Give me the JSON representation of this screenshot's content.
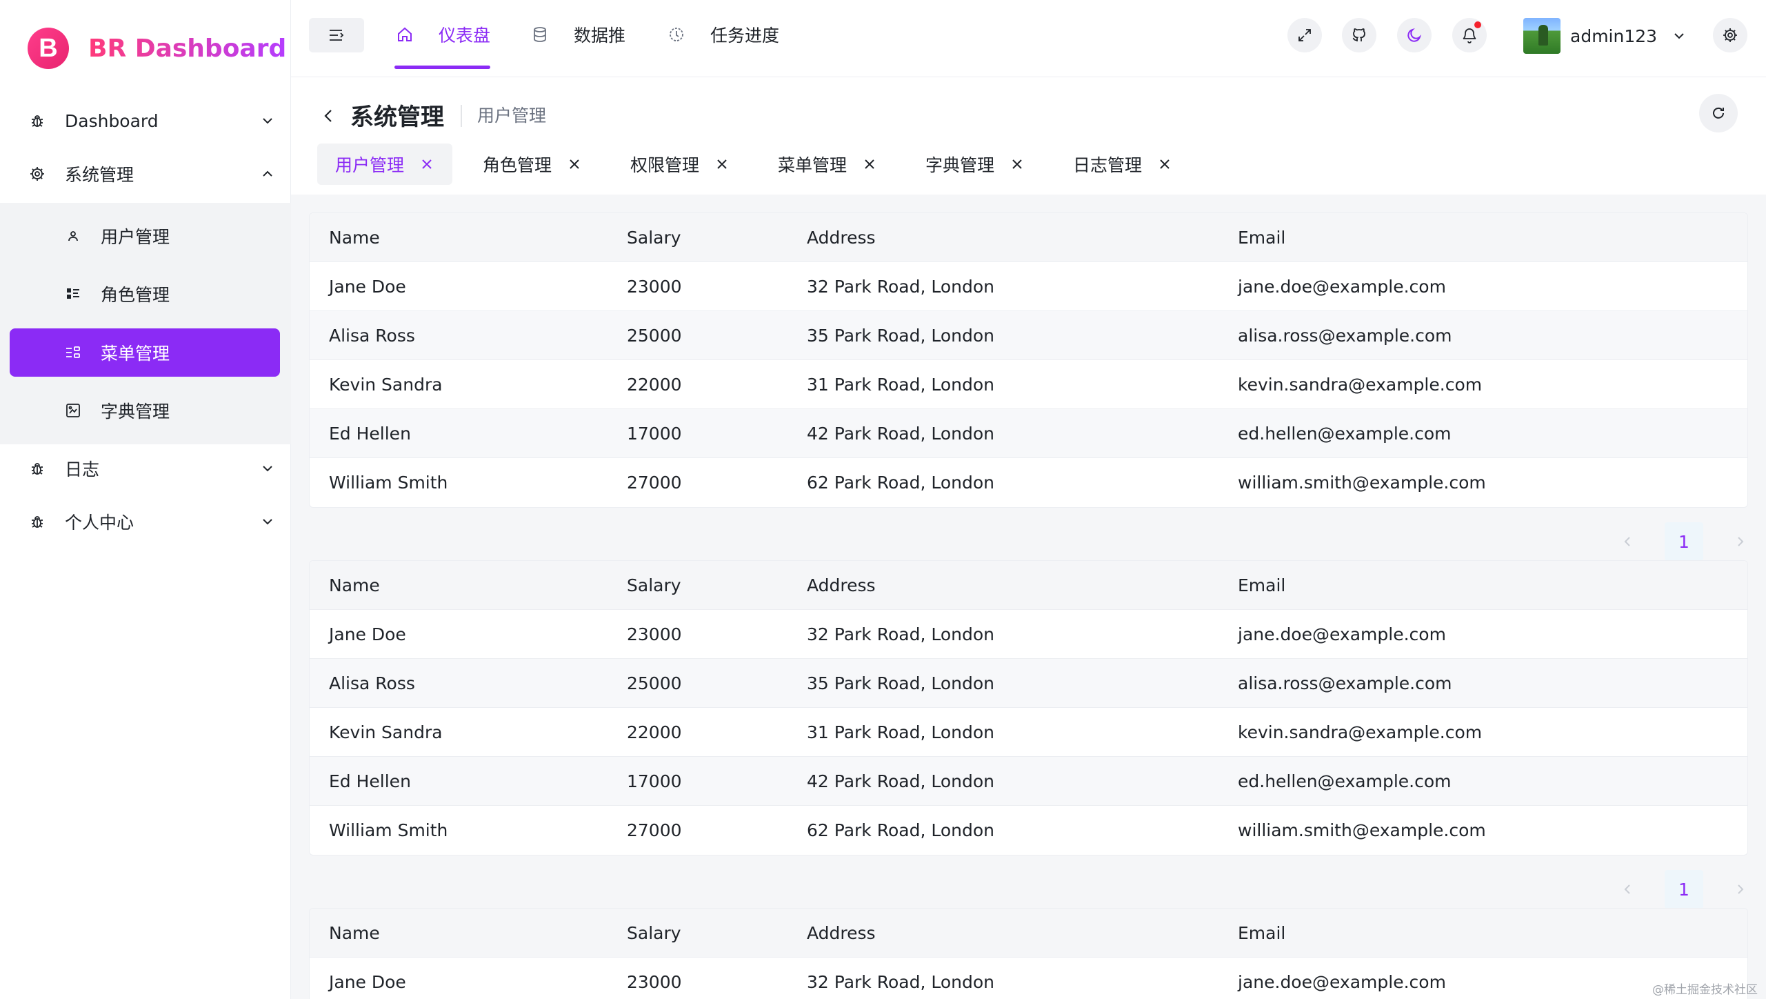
{
  "app": {
    "logo_letter": "B",
    "logo_text": "BR Dashboard"
  },
  "sidebar": {
    "groups": [
      {
        "label": "Dashboard",
        "icon": "bug-icon",
        "expanded": false
      },
      {
        "label": "系统管理",
        "icon": "gear-icon",
        "expanded": true
      },
      {
        "label": "日志",
        "icon": "bug-icon",
        "expanded": false
      },
      {
        "label": "个人中心",
        "icon": "bug-icon",
        "expanded": false
      }
    ],
    "sub_items": [
      {
        "label": "用户管理",
        "icon": "user-icon"
      },
      {
        "label": "角色管理",
        "icon": "role-list-icon"
      },
      {
        "label": "菜单管理",
        "icon": "menu-list-icon",
        "active": true
      },
      {
        "label": "字典管理",
        "icon": "dictionary-icon"
      }
    ]
  },
  "header": {
    "nav": [
      {
        "label": "仪表盘",
        "icon": "home-icon",
        "active": true
      },
      {
        "label": "数据推",
        "icon": "database-icon"
      },
      {
        "label": "任务进度",
        "icon": "progress-icon"
      }
    ],
    "actions": [
      "fullscreen-icon",
      "github-icon",
      "moon-icon",
      "bell-icon"
    ],
    "user": {
      "name": "admin123"
    }
  },
  "page": {
    "title": "系统管理",
    "subtitle": "用户管理",
    "tabs": [
      {
        "label": "用户管理",
        "active": true
      },
      {
        "label": "角色管理"
      },
      {
        "label": "权限管理"
      },
      {
        "label": "菜单管理"
      },
      {
        "label": "字典管理"
      },
      {
        "label": "日志管理"
      }
    ]
  },
  "table": {
    "columns": [
      "Name",
      "Salary",
      "Address",
      "Email"
    ],
    "rows": [
      [
        "Jane Doe",
        "23000",
        "32 Park Road, London",
        "jane.doe@example.com"
      ],
      [
        "Alisa Ross",
        "25000",
        "35 Park Road, London",
        "alisa.ross@example.com"
      ],
      [
        "Kevin Sandra",
        "22000",
        "31 Park Road, London",
        "kevin.sandra@example.com"
      ],
      [
        "Ed Hellen",
        "17000",
        "42 Park Road, London",
        "ed.hellen@example.com"
      ],
      [
        "William Smith",
        "27000",
        "62 Park Road, London",
        "william.smith@example.com"
      ]
    ]
  },
  "pagination": {
    "current": "1"
  },
  "watermark": "@稀土掘金技术社区",
  "colors": {
    "accent": "#8b2bf5",
    "logo": "#ff3d8b",
    "notification": "#f5222d"
  }
}
